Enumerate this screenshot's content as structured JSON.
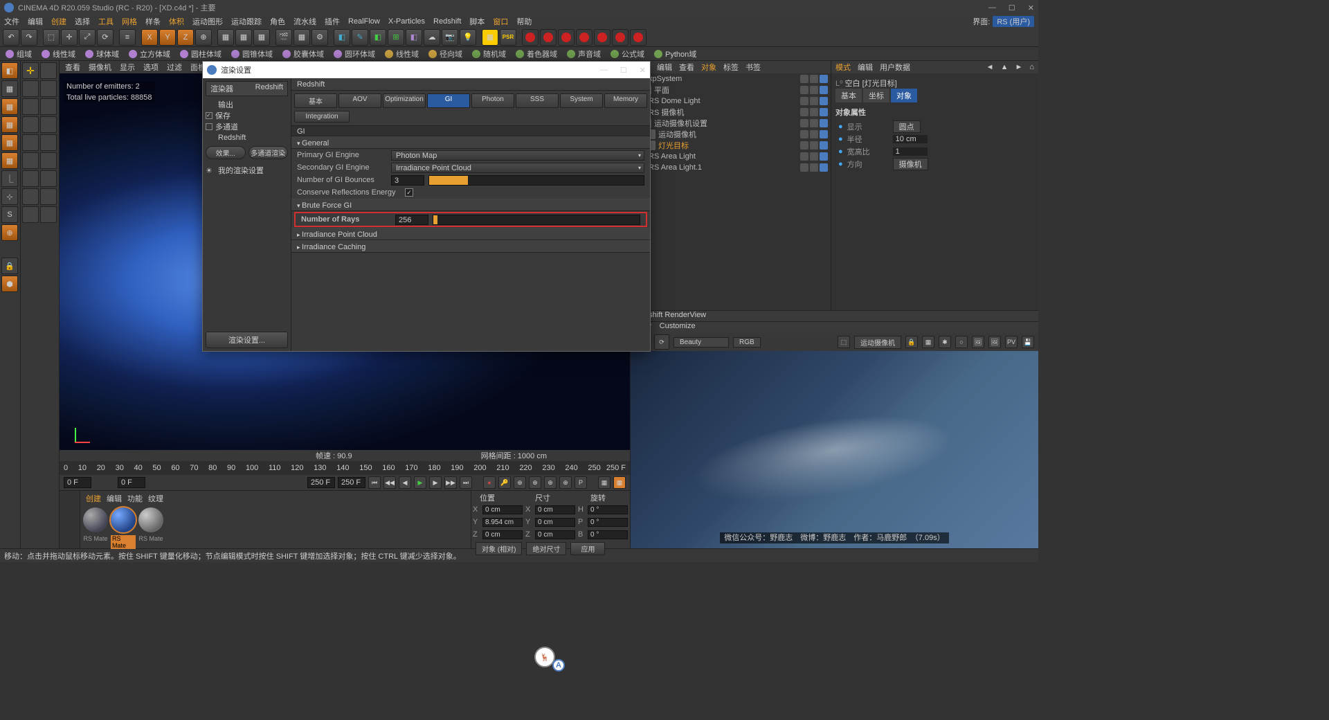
{
  "title": "CINEMA 4D R20.059 Studio (RC - R20) - [XD.c4d *] - 主要",
  "menus": [
    "文件",
    "编辑",
    "创建",
    "选择",
    "工具",
    "网格",
    "样条",
    "体积",
    "运动图形",
    "运动跟踪",
    "角色",
    "流水线",
    "插件",
    "RealFlow",
    "X-Particles",
    "Redshift",
    "脚本",
    "窗口",
    "帮助"
  ],
  "menu_right": {
    "label": "界面:",
    "value": "RS (用户)"
  },
  "toolbar2": [
    {
      "label": "组域",
      "color": "#b080d0"
    },
    {
      "label": "线性域",
      "color": "#b080d0"
    },
    {
      "label": "球体域",
      "color": "#b080d0"
    },
    {
      "label": "立方体域",
      "color": "#b080d0"
    },
    {
      "label": "圆柱体域",
      "color": "#b080d0"
    },
    {
      "label": "圆锥体域",
      "color": "#b080d0"
    },
    {
      "label": "胶囊体域",
      "color": "#b080d0"
    },
    {
      "label": "圆环体域",
      "color": "#b080d0"
    },
    {
      "label": "线性域",
      "color": "#c8a040"
    },
    {
      "label": "径向域",
      "color": "#c8a040"
    },
    {
      "label": "随机域",
      "color": "#70a050"
    },
    {
      "label": "着色器域",
      "color": "#70a050"
    },
    {
      "label": "声音域",
      "color": "#70a050"
    },
    {
      "label": "公式域",
      "color": "#70a050"
    },
    {
      "label": "Python域",
      "color": "#70a050"
    }
  ],
  "vpmenu": [
    "查看",
    "摄像机",
    "显示",
    "选项",
    "过滤",
    "面板"
  ],
  "hud": {
    "emitters": "Number of emitters: 2",
    "particles": "Total live particles: 88858"
  },
  "vpfoot": {
    "speed": "帧速 : 90.9",
    "grid": "网格间距 : 1000 cm"
  },
  "timeline": {
    "ticks": [
      "0",
      "10",
      "20",
      "30",
      "40",
      "50",
      "60",
      "70",
      "80",
      "90",
      "100",
      "110",
      "120",
      "130",
      "140",
      "150",
      "160",
      "170",
      "180",
      "190",
      "200",
      "210",
      "220",
      "230",
      "240",
      "250"
    ],
    "end": "250 F"
  },
  "play": {
    "start": "0 F",
    "from": "0 F",
    "to": "250 F",
    "end": "250 F"
  },
  "mattabs": [
    "创建",
    "编辑",
    "功能",
    "纹理"
  ],
  "mats": [
    "RS Mate",
    "RS Mate",
    "RS Mate"
  ],
  "obj": {
    "tabs": [
      "文件",
      "编辑",
      "查看",
      "对象",
      "标签",
      "书签"
    ],
    "items": [
      {
        "name": "xpSystem",
        "cls": ""
      },
      {
        "name": "平面",
        "cls": "",
        "indent": 8
      },
      {
        "name": "RS Dome Light",
        "cls": ""
      },
      {
        "name": "RS 摄像机",
        "cls": ""
      },
      {
        "name": "运动摄像机设置",
        "cls": "",
        "indent": 8
      },
      {
        "name": "运动摄像机",
        "cls": "",
        "indent": 14
      },
      {
        "name": "灯光目标",
        "cls": "or",
        "indent": 14
      },
      {
        "name": "RS Area Light",
        "cls": ""
      },
      {
        "name": "RS Area Light.1",
        "cls": ""
      }
    ]
  },
  "attr": {
    "tabs": [
      "模式",
      "编辑",
      "用户数据"
    ],
    "title": "空白 [灯光目标]",
    "subtabs": [
      "基本",
      "坐标",
      "对象"
    ],
    "heading": "对象属性",
    "rows": [
      {
        "label": "显示",
        "value": "圆点",
        "type": "dd"
      },
      {
        "label": "半径",
        "value": "10 cm",
        "type": "num"
      },
      {
        "label": "宽高比",
        "value": "1",
        "type": "num"
      },
      {
        "label": "方向",
        "value": "摄像机",
        "type": "dd"
      }
    ]
  },
  "rv": {
    "title": "Redshift RenderView",
    "menus": [
      "View",
      "Customize"
    ],
    "pass": "Beauty",
    "rgb": "RGB",
    "cam": "运动摄像机",
    "credit": "微信公众号：野鹿志　微博：野鹿志　作者：马鹿野郎　（7.09s）"
  },
  "pos": {
    "heads": [
      "位置",
      "尺寸",
      "旋转"
    ],
    "rows": [
      {
        "a": "X",
        "p": "0 cm",
        "s": "0 cm",
        "r": "H",
        "rv": "0 °"
      },
      {
        "a": "Y",
        "p": "8.954 cm",
        "s": "0 cm",
        "r": "P",
        "rv": "0 °"
      },
      {
        "a": "Z",
        "p": "0 cm",
        "s": "0 cm",
        "r": "B",
        "rv": "0 °"
      }
    ],
    "dd1": "对象 (相对)",
    "dd2": "绝对尺寸",
    "btn": "应用"
  },
  "dlg": {
    "title": "渲染设置",
    "renderer_label": "渲染器",
    "renderer": "Redshift",
    "left": [
      "输出",
      "保存",
      "多通道",
      "Redshift"
    ],
    "leftbtns": [
      "效果...",
      "多通道渲染"
    ],
    "mine": "我的渲染设置",
    "bottom": "渲染设置...",
    "rtit": "Redshift",
    "tabs": [
      "基本",
      "AOV",
      "Optimization",
      "GI",
      "Photon",
      "SSS",
      "System",
      "Memory"
    ],
    "tab2": "Integration",
    "gi": "GI",
    "sections": {
      "general": "General",
      "rows1": [
        {
          "label": "Primary GI Engine",
          "value": "Photon Map",
          "type": "dd"
        },
        {
          "label": "Secondary GI Engine",
          "value": "Irradiance Point Cloud",
          "type": "dd"
        },
        {
          "label": "Number of GI Bounces",
          "value": "3",
          "type": "slider",
          "pct": 18
        },
        {
          "label": "Conserve Reflections Energy",
          "type": "chk",
          "on": true
        }
      ],
      "brute": "Brute Force GI",
      "rays": {
        "label": "Number of Rays",
        "value": "256",
        "pct": 2
      },
      "ipc": "Irradiance Point Cloud",
      "ic": "Irradiance Caching"
    }
  },
  "status": "移动：点击并拖动鼠标移动元素。按住 SHIFT 键量化移动；节点编辑模式时按住 SHIFT 键增加选择对象；按住 CTRL 键减少选择对象。"
}
